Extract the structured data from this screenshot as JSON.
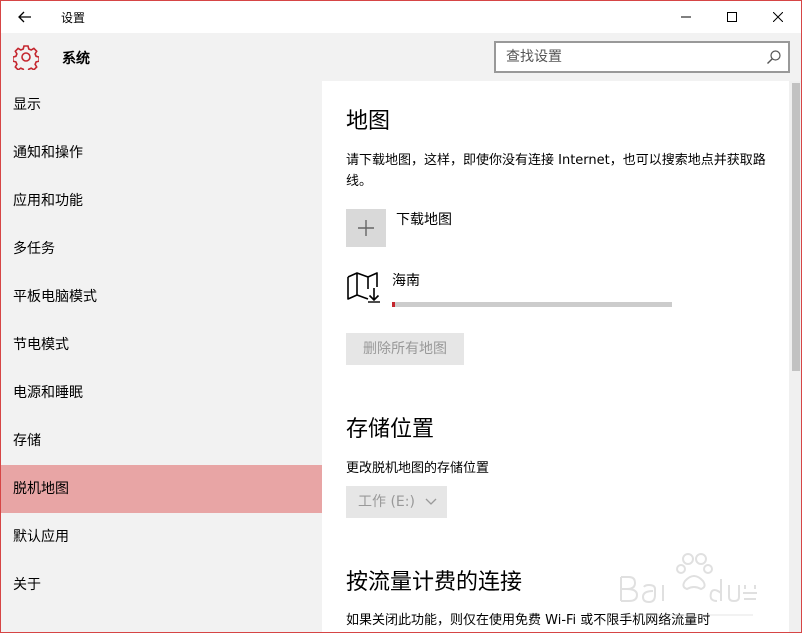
{
  "window": {
    "title": "设置",
    "back_icon": "back-arrow-icon",
    "controls": [
      "minimize-icon",
      "maximize-icon",
      "close-icon"
    ]
  },
  "header": {
    "icon": "gear-icon",
    "title": "系统",
    "search_placeholder": "查找设置",
    "search_icon": "search-icon"
  },
  "sidebar": {
    "items": [
      {
        "label": "显示"
      },
      {
        "label": "通知和操作"
      },
      {
        "label": "应用和功能"
      },
      {
        "label": "多任务"
      },
      {
        "label": "平板电脑模式"
      },
      {
        "label": "节电模式"
      },
      {
        "label": "电源和睡眠"
      },
      {
        "label": "存储"
      },
      {
        "label": "脱机地图",
        "selected": true
      },
      {
        "label": "默认应用"
      },
      {
        "label": "关于"
      }
    ]
  },
  "main": {
    "maps": {
      "title": "地图",
      "description": "请下载地图，这样，即使你没有连接 Internet，也可以搜索地点并获取路线。",
      "download_label": "下载地图",
      "download_item": {
        "name": "海南",
        "progress": 0.01
      },
      "delete_all_label": "删除所有地图"
    },
    "storage": {
      "title": "存储位置",
      "description": "更改脱机地图的存储位置",
      "drive_value": "工作 (E:)"
    },
    "metered": {
      "title": "按流量计费的连接",
      "description": "如果关闭此功能，则仅在使用免费 Wi-Fi 或不限手机网络流量时"
    }
  },
  "colors": {
    "accent": "#c4262e",
    "selected_bg": "#e8a5a5",
    "sidebar_bg": "#f2f2f2",
    "window_border": "#d64545"
  }
}
